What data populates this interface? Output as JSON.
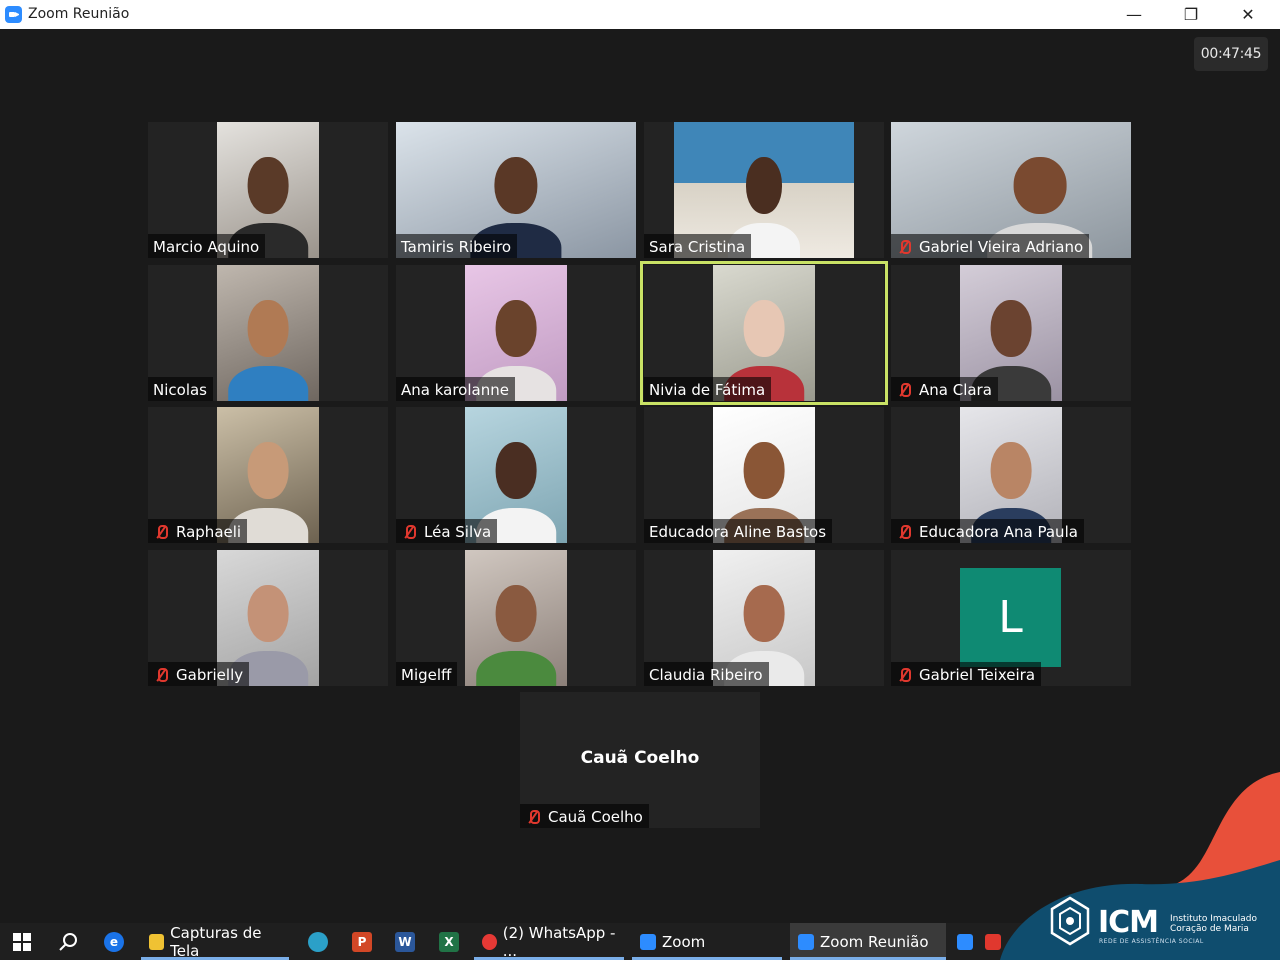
{
  "window": {
    "title": "Zoom Reunião",
    "minimize": "—",
    "maximize": "❐",
    "close": "✕"
  },
  "meeting": {
    "timer": "00:47:45",
    "participants": [
      {
        "name": "Marcio Aquino",
        "muted": false
      },
      {
        "name": "Tamiris Ribeiro",
        "muted": false
      },
      {
        "name": "Sara Cristina",
        "muted": false
      },
      {
        "name": "Gabriel Vieira Adriano",
        "muted": true
      },
      {
        "name": "Nicolas",
        "muted": false
      },
      {
        "name": "Ana karolanne",
        "muted": false
      },
      {
        "name": "Nivia de Fátima",
        "muted": false,
        "active_speaker": true
      },
      {
        "name": "Ana Clara",
        "muted": true
      },
      {
        "name": "Raphaeli",
        "muted": true
      },
      {
        "name": "Léa Silva",
        "muted": true
      },
      {
        "name": "Educadora Aline Bastos",
        "muted": false
      },
      {
        "name": "Educadora Ana Paula",
        "muted": true
      },
      {
        "name": "Gabrielly",
        "muted": true
      },
      {
        "name": "Migelff",
        "muted": false
      },
      {
        "name": "Claudia Ribeiro",
        "muted": false
      },
      {
        "name": "Gabriel Teixeira",
        "muted": true,
        "avatar_letter": "L"
      },
      {
        "name": "Cauã Coelho",
        "muted": true,
        "camera_off_label": "Cauã Coelho"
      }
    ],
    "colors": {
      "active_border": "#c9e265",
      "muted_icon": "#e0382e",
      "avatar_bg": "#0f8a73"
    }
  },
  "taskbar": {
    "items": [
      {
        "label": "Capturas de Tela",
        "icon": "folder-icon"
      },
      {
        "label": "(2) WhatsApp - ...",
        "icon": "chrome-icon"
      },
      {
        "label": "Zoom",
        "icon": "zoom-icon"
      },
      {
        "label": "Zoom Reunião",
        "icon": "zoom-icon",
        "active": true
      }
    ],
    "pinned": [
      "windows-start-icon",
      "search-icon",
      "edge-legacy-icon",
      "edge-icon",
      "powerpoint-icon",
      "word-icon",
      "excel-icon",
      "zoom-icon",
      "zoom-alt-icon"
    ]
  },
  "logo": {
    "name": "ICM",
    "line1": "Instituto Imaculado",
    "line2": "Coração de Maria",
    "line3": "REDE DE ASSISTÊNCIA SOCIAL"
  }
}
